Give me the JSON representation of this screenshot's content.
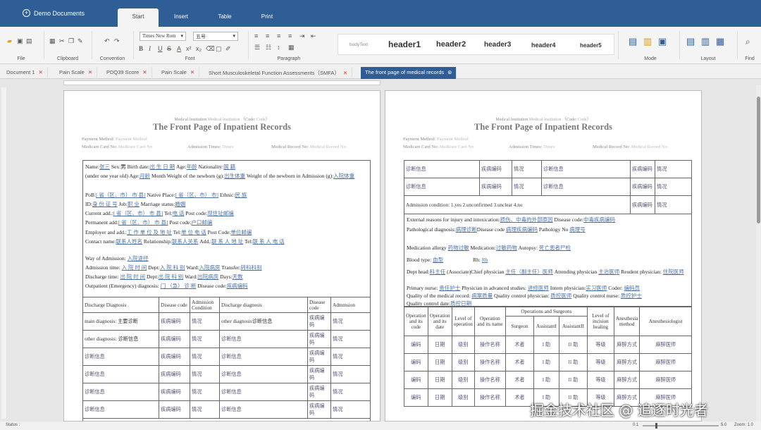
{
  "app": {
    "demo_documents": "Demo Documents"
  },
  "menu": [
    "Start",
    "Insert",
    "Table",
    "Print"
  ],
  "ribbon": {
    "file": "File",
    "clipboard": "Clipboard",
    "convention": "Convention",
    "font": "Font",
    "paragraph": "Paragraph",
    "mode": "Mode",
    "layout": "Layout",
    "find": "Find",
    "font_name": "Times New Rom",
    "font_size": "五号",
    "styles": {
      "body": "bodyText",
      "h1": "header1",
      "h2": "header2",
      "h3": "header3",
      "h4": "header4",
      "h5": "header5"
    }
  },
  "doc_tabs": [
    "Document 1",
    "Pain Scale",
    "PDQ39 Score",
    "Pain Scale",
    "Short Musculoskeletal Function Assessments（SMFA）",
    "The front page of medical records"
  ],
  "page": {
    "institution": "Medical Institution",
    "institution_ph": "Medical Institution",
    "code": "（Code:",
    "code_ph": "Code",
    "title": "The Front Page of Inpatient Records",
    "payment": "Payment Method:",
    "payment_ph": "Payment Method",
    "card": "Medicare Card No:",
    "card_ph": "Medicare Card No",
    "admission_times": "Admission Times:",
    "admission_times_ph": "Times",
    "record": "Medical Record No:",
    "record_ph": "Medical Record No"
  },
  "left_form": {
    "name": "Name:",
    "name_v": "张三",
    "sex": "Sex:男",
    "birth": "Birth date:",
    "birth_v": "出  生  日  期",
    "age": "Age:",
    "age_v": "年龄",
    "nat": "Nationality:",
    "nat_v": "国    籍",
    "infant": "(under one year old) Age:",
    "months": "月龄",
    "month_w": "Month  Weight of the newborn (g):",
    "bw": "出生体重",
    "adm_w": "Weight of the newborn in Admission (g):",
    "adm_w_v": "入院体重",
    "pob": "PoB:",
    "pob_v": "[     省（区、市）    市     县]",
    "native": "Native Place:",
    "native_v": "[      省（区、市）    市]",
    "ethnic": "Ethnic:",
    "ethnic_v": "民  族",
    "id": "ID:",
    "id_v": "身        份        证        号",
    "job": "Job:",
    "job_v": "职            业",
    "marriage": "Marriage status:",
    "marriage_v": "婚姻",
    "cur": "Current add.:",
    "cur_v": "[        省（区、市）    市     县]",
    "tel": "Tel:",
    "tel_v": "电            话",
    "post": "Post code:",
    "post_v": "现住址邮编",
    "perm": "Permanent add:",
    "perm_v": "[        省（区、市）    市     县]",
    "post2": "Post code:",
    "post2_v": "户口邮编",
    "emp": "Employer and add.:",
    "emp_v": "工   作   单   位   及   地   址",
    "tel2": "Tel:",
    "tel2_v": "单   位   电   话",
    "post3": "Post Code:",
    "post3_v": "单位邮编",
    "contact": "Contact name:",
    "contact_v": "联系人姓名",
    "rel": "Relationship:",
    "rel_v": "联系人关系",
    "add": "Add.:",
    "add_v": "联   系   人   地   址",
    "tel3": "Tel:",
    "tel3_v": "联  系  人  电  话",
    "way": "Way of Admission:",
    "way_v": "入院途径",
    "atime": "Admission time:",
    "atime_v": "入     院     时     间",
    "dept": "Dept:",
    "dept_v": "入 院 科 别",
    "ward": "Ward:",
    "ward_v": "入院病房",
    "transfer": "Transfer:",
    "transfer_v": "转科科别",
    "dtime": "Discharge time:",
    "dtime_v": "出     院     时     间",
    "dept2": "Dept:",
    "dept2_v": "出 院 科 别",
    "ward2": "Ward:",
    "ward2_v": "出院病房",
    "days": "Days:",
    "days_v": "天数",
    "opd": "Outpatient (Emergency) diagnosis:",
    "opd_v": "门           （急）          诊           断",
    "dcode": "Disease code:",
    "dcode_v": "疾病编码",
    "table_head": [
      "Discharge Diagnosis",
      "Disease code",
      "Admission Condition",
      "Discharge diagnosis",
      "Disease code",
      "Admmsion"
    ],
    "table_rows": [
      [
        "main diagnosis: 主要诊断",
        "疾病编码",
        "情况",
        "other diagnosis诊断信息",
        "疾病编码",
        "情况"
      ],
      [
        "other diagnosis: 诊断信息",
        "疾病编码",
        "情况",
        "诊断信息",
        "疾病编码",
        "情况"
      ],
      [
        "诊断信息",
        "疾病编码",
        "情况",
        "诊断信息",
        "疾病编码",
        "情况"
      ],
      [
        "诊断信息",
        "疾病编码",
        "情况",
        "诊断信息",
        "疾病编码",
        "情况"
      ],
      [
        "诊断信息",
        "疾病编码",
        "情况",
        "诊断信息",
        "疾病编码",
        "情况"
      ],
      [
        "诊断信息",
        "疾病编码",
        "情况",
        "诊断信息",
        "疾病编码",
        "情况"
      ]
    ]
  },
  "right_form": {
    "top_rows": [
      [
        "诊断信息",
        "疾病编码",
        "情况",
        "诊断信息",
        "疾病编码",
        "情况"
      ],
      [
        "诊断信息",
        "疾病编码",
        "情况",
        "诊断信息",
        "疾病编码",
        "情况"
      ]
    ],
    "adm_cond": "Admission  condition:  1.yes  2.unconfirmed  3.unclear  4.no",
    "adm_c3": "疾病编码",
    "adm_c4": "情况",
    "ext": "External reasons for injury and intoxication:",
    "ext_v": "损伤、中毒的外部原因",
    "ext_code": "Disease code:",
    "ext_code_v": "中毒疾病编码",
    "path": "Pathological diagnosis:",
    "path_v": "病理诊断",
    "path_code": "Disease code",
    "path_code_v": "病理疾病编码",
    "path_no": "Pathology No",
    "path_no_v": "病理号",
    "allergy": "Medication allergy",
    "allergy_v": "药物过敏",
    "med": "Medication:",
    "med_v": "过敏药物",
    "autopsy": "Autopsy:",
    "autopsy_v": "死亡患者尸检",
    "blood": "Blood type:",
    "blood_v": "血型",
    "rh": "Rh:",
    "rh_v": "Rh",
    "depthead": "Dept head:",
    "depthead_v": "科主任",
    "assoc": "(Associate)Chief physician",
    "assoc_v": "主任（副主任）医师",
    "attend": "Attending physician",
    "attend_v": "主治医师",
    "resid": "Reudent physician:",
    "resid_v": "住院医师",
    "nurse": "Primary nurse:",
    "nurse_v": "责任护士",
    "adv": "Physician in advanced studies:",
    "adv_v": "进修医师",
    "intern": "Intern physician:",
    "intern_v": "实习医师",
    "coder": "Coder:",
    "coder_v": "编码员",
    "quality": "Quality of the medical record:",
    "quality_v": "病案质量",
    "qphys": "Quality control physician:",
    "qphys_v": "质控医师",
    "qnurse": "Quality control nurse:",
    "qnurse_v": "质控护士",
    "qdate": "Quality control date:",
    "qdate_v": "质控日期",
    "op_head": [
      "Operation and its code",
      "Operation and its date",
      "Level of operation",
      "Operation and its name",
      "Operations and Surgeons",
      "Level of incision healing",
      "Anesthesia method",
      "Anesthesiologist"
    ],
    "op_sub": [
      "Surgeon",
      "AssistantI",
      "AssistantII"
    ],
    "op_rows": [
      [
        "编码",
        "日期",
        "级别",
        "操作名称",
        "术者",
        "I 助",
        "II 助",
        "等级",
        "麻醉方式",
        "麻醉医师"
      ],
      [
        "编码",
        "日期",
        "级别",
        "操作名称",
        "术者",
        "I 助",
        "II 助",
        "等级",
        "麻醉方式",
        "麻醉医师"
      ],
      [
        "编码",
        "日期",
        "级别",
        "操作名称",
        "术者",
        "I 助",
        "II 助",
        "等级",
        "麻醉方式",
        "麻醉医师"
      ],
      [
        "编码",
        "日期",
        "级别",
        "操作名称",
        "术者",
        "I 助",
        "II 助",
        "等级",
        "麻醉方式",
        "麻醉医师"
      ]
    ]
  },
  "status": {
    "label": "Status :",
    "zoom_min": "0.1",
    "zoom_max": "5.0",
    "zoom": "Zoom: 1.0"
  },
  "watermark": "掘金技术社区 @ 追逐时光者"
}
